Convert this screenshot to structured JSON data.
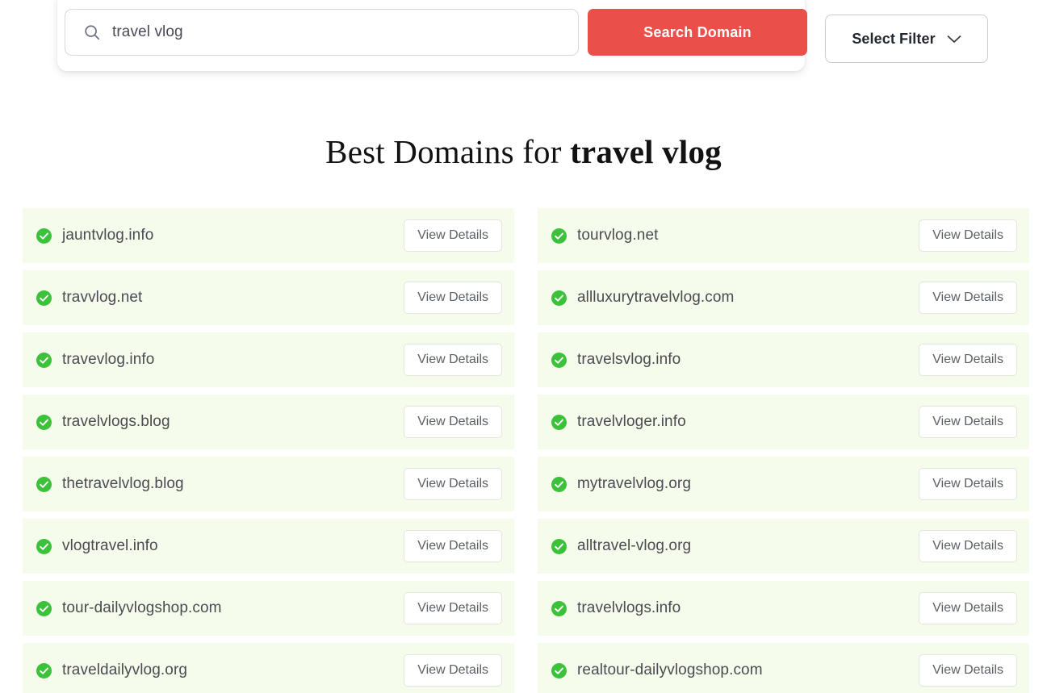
{
  "search": {
    "value": "travel vlog",
    "placeholder": "Search for a domain",
    "icon": "search-icon",
    "submit_label": "Search Domain",
    "accent_color": "#ea4f4a"
  },
  "filter": {
    "label": "Select Filter",
    "icon": "chevron-down-icon"
  },
  "heading": {
    "prefix": "Best Domains for ",
    "keyword": "travel vlog"
  },
  "results": {
    "available_icon": "check-circle-icon",
    "available_color": "#3cc13b",
    "row_background": "#f5fcec",
    "details_label": "View Details",
    "left_column": [
      {
        "domain": "jauntvlog.info"
      },
      {
        "domain": "travvlog.net"
      },
      {
        "domain": "travevlog.info"
      },
      {
        "domain": "travelvlogs.blog"
      },
      {
        "domain": "thetravelvlog.blog"
      },
      {
        "domain": "vlogtravel.info"
      },
      {
        "domain": "tour-dailyvlogshop.com"
      },
      {
        "domain": "traveldailyvlog.org"
      }
    ],
    "right_column": [
      {
        "domain": "tourvlog.net"
      },
      {
        "domain": "allluxurytravelvlog.com"
      },
      {
        "domain": "travelsvlog.info"
      },
      {
        "domain": "travelvloger.info"
      },
      {
        "domain": "mytravelvlog.org"
      },
      {
        "domain": "alltravel-vlog.org"
      },
      {
        "domain": "travelvlogs.info"
      },
      {
        "domain": "realtour-dailyvlogshop.com"
      }
    ]
  }
}
